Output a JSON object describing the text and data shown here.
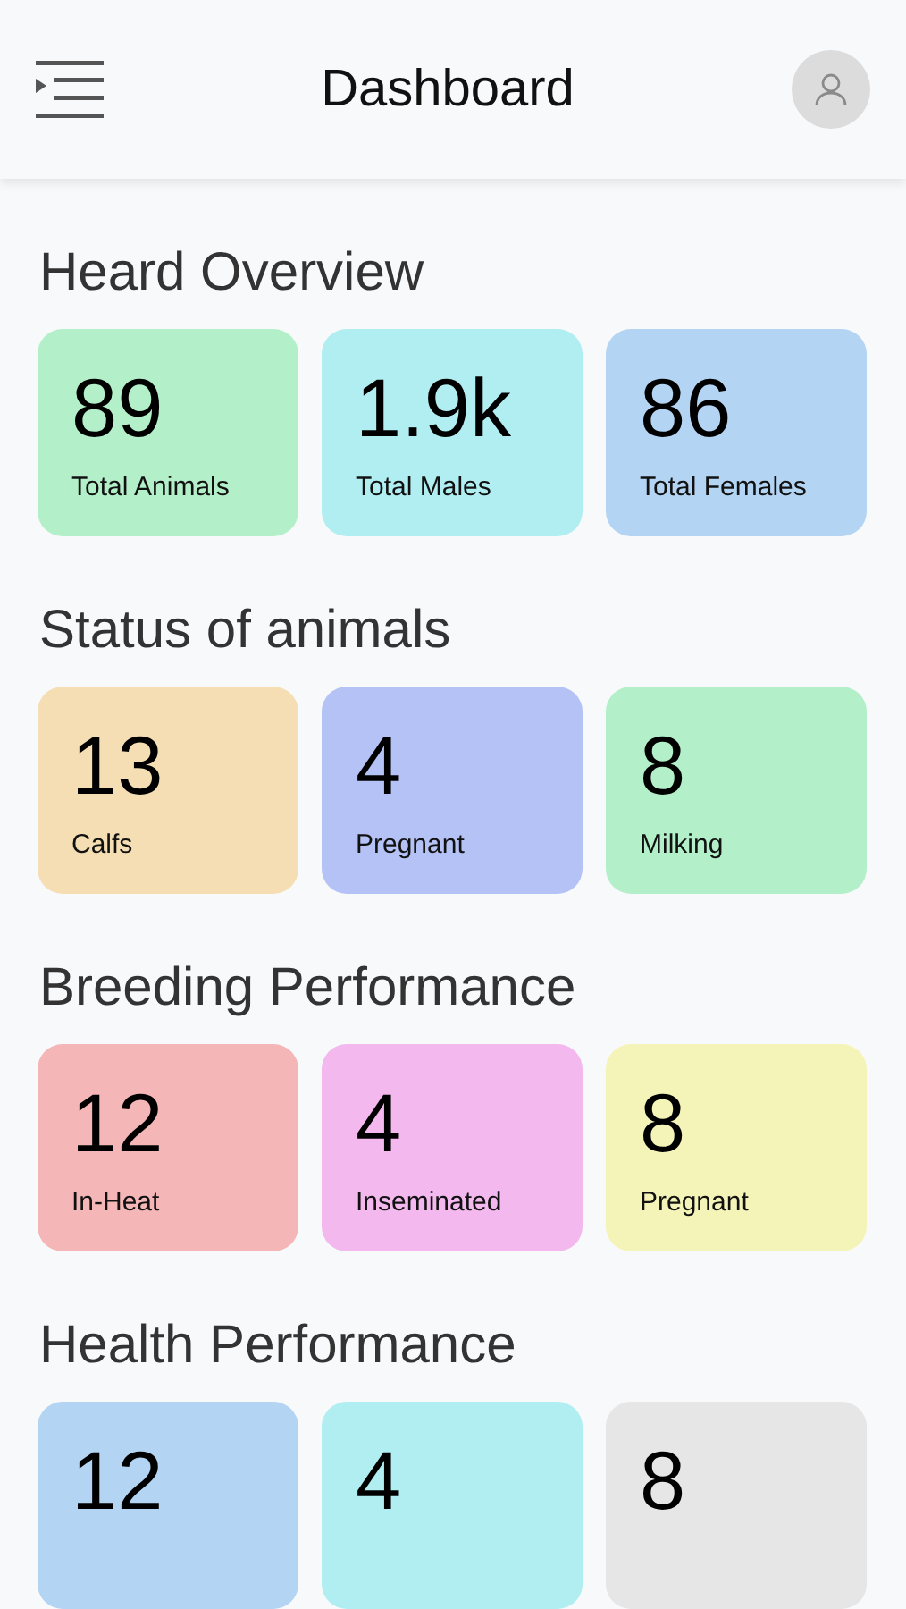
{
  "header": {
    "title": "Dashboard"
  },
  "sections": [
    {
      "title": "Heard Overview",
      "cards": [
        {
          "value": "89",
          "label": "Total Animals",
          "color": "#b3f0c9"
        },
        {
          "value": "1.9k",
          "label": "Total Males",
          "color": "#b0eef2"
        },
        {
          "value": "86",
          "label": "Total Females",
          "color": "#b3d4f2"
        }
      ]
    },
    {
      "title": "Status of animals",
      "cards": [
        {
          "value": "13",
          "label": "Calfs",
          "color": "#f5deb3"
        },
        {
          "value": "4",
          "label": "Pregnant",
          "color": "#b5c2f5"
        },
        {
          "value": "8",
          "label": "Milking",
          "color": "#b3f0c9"
        }
      ]
    },
    {
      "title": "Breeding Performance",
      "cards": [
        {
          "value": "12",
          "label": "In-Heat",
          "color": "#f4b6b6"
        },
        {
          "value": "4",
          "label": "Inseminated",
          "color": "#f3b8ee"
        },
        {
          "value": "8",
          "label": "Pregnant",
          "color": "#f4f4b8"
        }
      ]
    },
    {
      "title": "Health Performance",
      "cards": [
        {
          "value": "12",
          "color": "#b3d4f2"
        },
        {
          "value": "4",
          "color": "#b0eef2"
        },
        {
          "value": "8",
          "color": "#e6e6e6"
        }
      ]
    }
  ]
}
